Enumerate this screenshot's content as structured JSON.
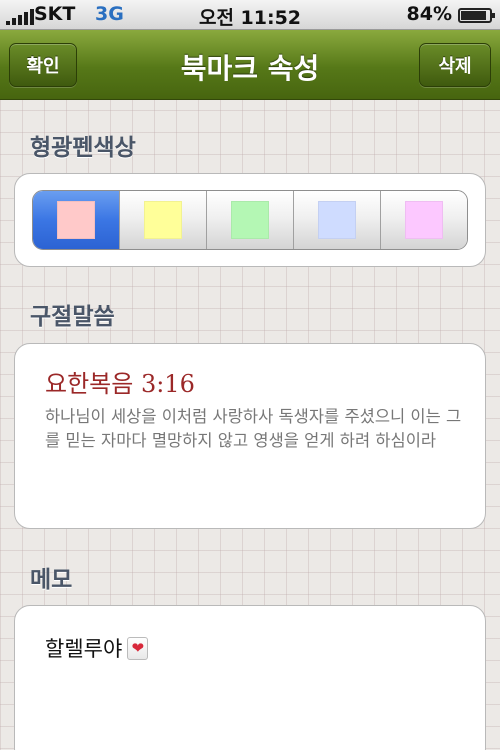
{
  "status_bar": {
    "carrier": "SKT",
    "network": "3G",
    "time": "오전 11:52",
    "battery_percent": "84%",
    "battery_level": 0.84
  },
  "nav": {
    "title": "북마크 속성",
    "left_button": "확인",
    "right_button": "삭제"
  },
  "highlight": {
    "header": "형광펜색상",
    "selected_index": 0,
    "colors": [
      "#ffc9c9",
      "#ffff99",
      "#b4f7b4",
      "#cfdcff",
      "#fcc8ff"
    ]
  },
  "verse": {
    "header": "구절말씀",
    "reference": "요한복음 3:16",
    "text": "하나님이 세상을 이처럼 사랑하사 독생자를 주셨으니 이는 그를 믿는 자마다 멸망하지 않고 영생을 얻게 하려 하심이라"
  },
  "memo": {
    "header": "메모",
    "text": "할렐루야",
    "emoji_icon": "heart-icon"
  }
}
